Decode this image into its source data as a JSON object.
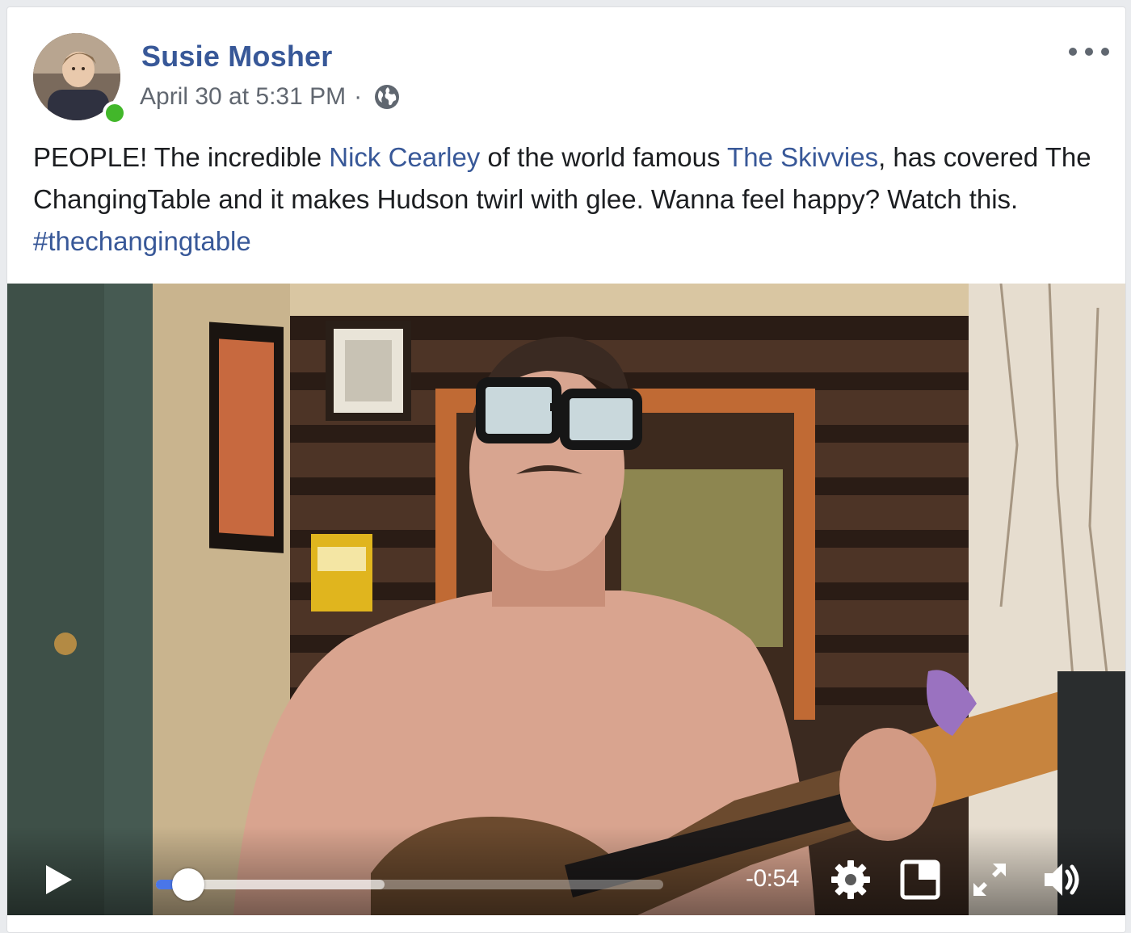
{
  "post": {
    "author": "Susie Mosher",
    "timestamp": "April 30 at 5:31 PM",
    "separator": "·",
    "privacy_icon": "globe-icon",
    "more_icon": "more-options-icon",
    "online": true,
    "text": {
      "p1": "PEOPLE! The incredible ",
      "link1": "Nick Cearley",
      "p2": " of the world famous ",
      "link2": "The Skivvies",
      "p3": ", has covered The ChangingTable and it makes Hudson twirl with glee. Wanna feel happy? Watch this. ",
      "hashtag": "#thechangingtable"
    }
  },
  "video": {
    "time_remaining": "-0:54",
    "played_fraction": 0.063,
    "buffered_fraction": 0.45,
    "icons": [
      "play-icon",
      "settings-gear-icon",
      "picture-in-picture-icon",
      "fullscreen-icon",
      "volume-icon"
    ]
  },
  "colors": {
    "link": "#385898",
    "online": "#42b72a",
    "progress": "#4a76e8"
  }
}
